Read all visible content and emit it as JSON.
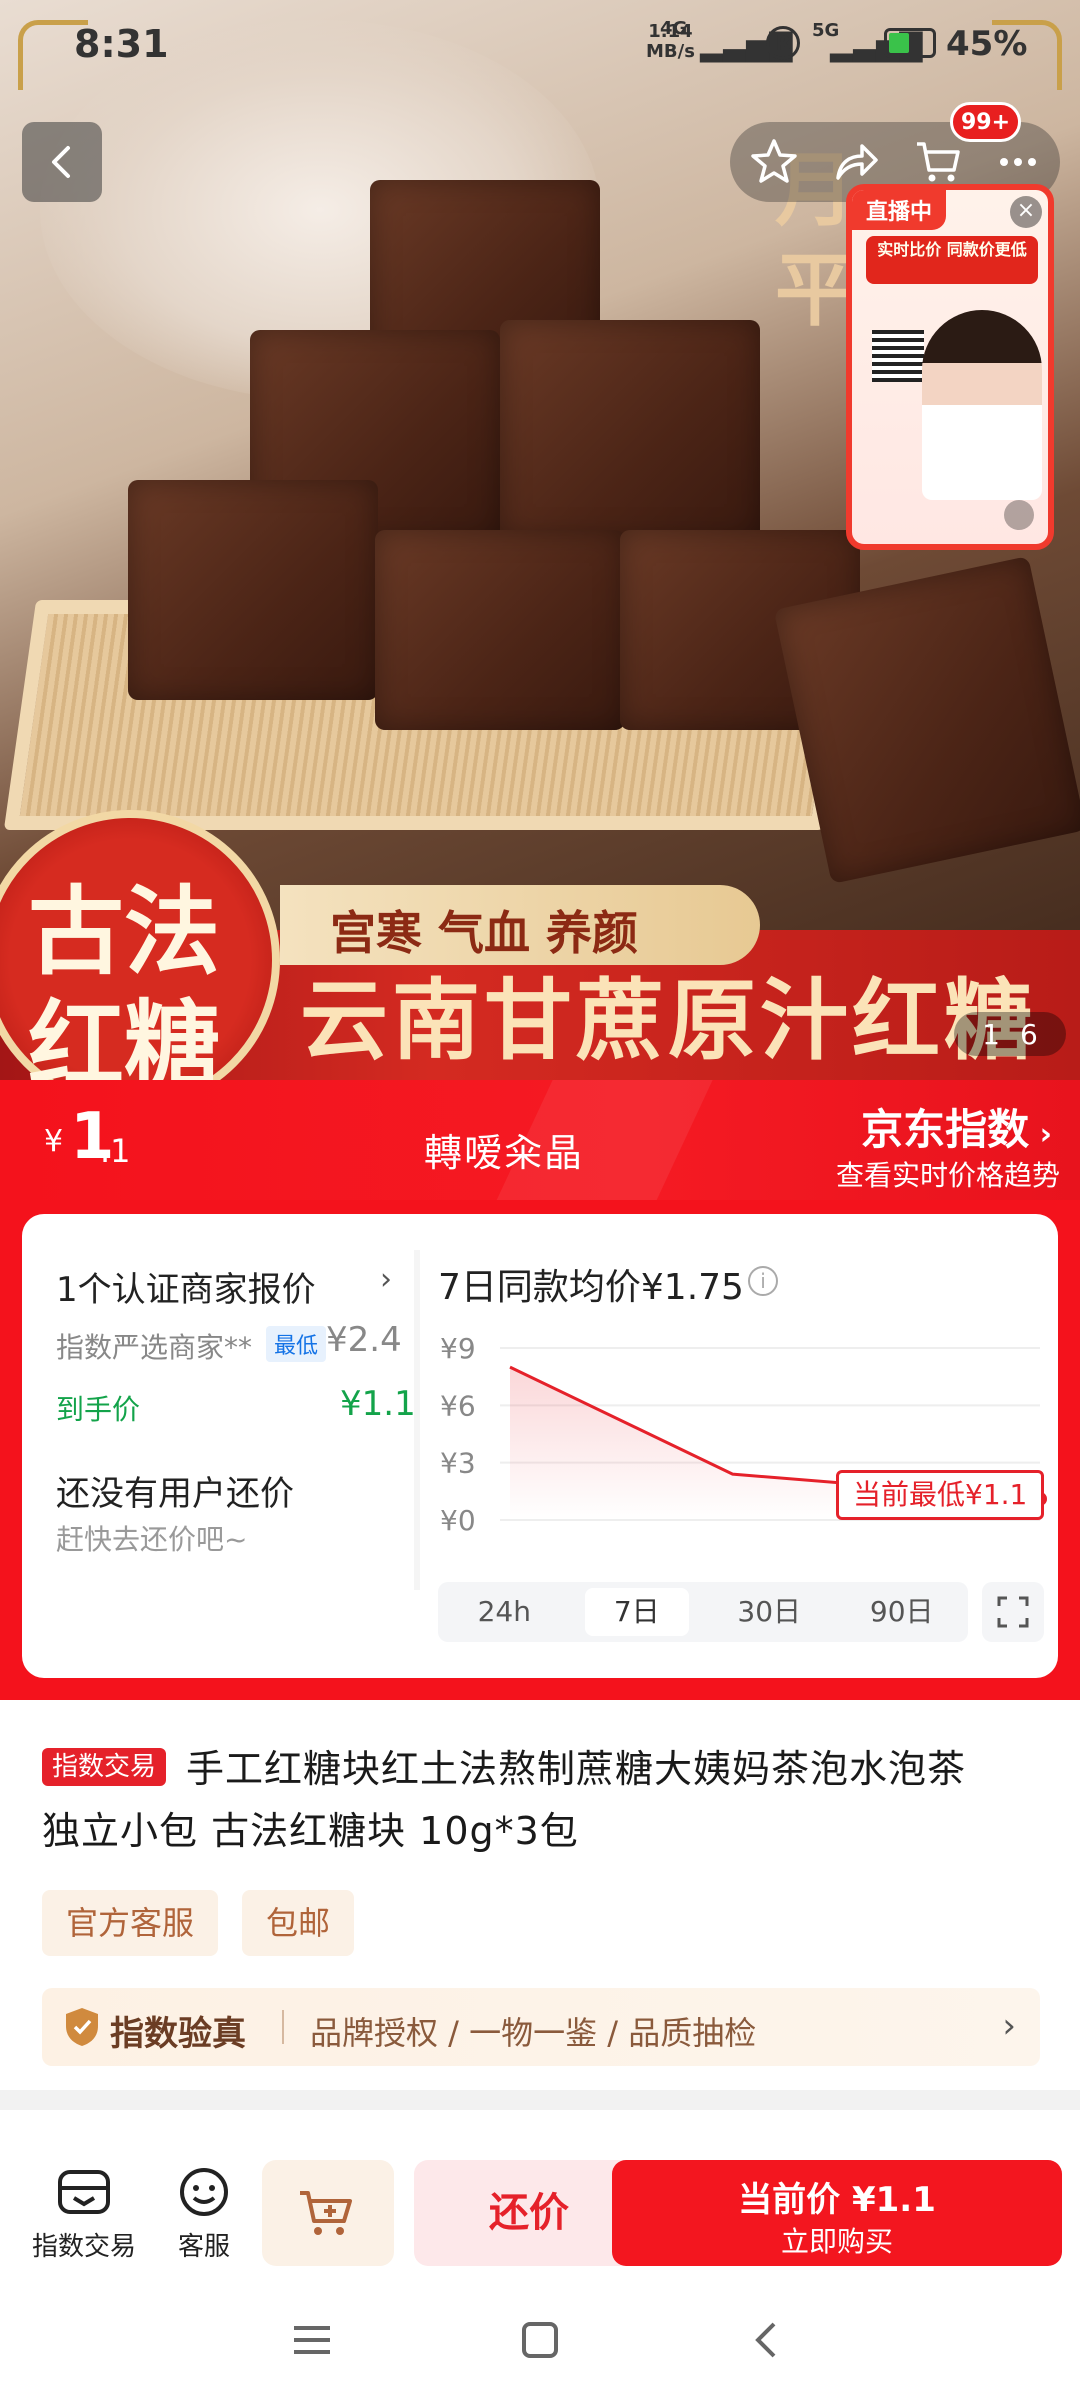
{
  "status_bar": {
    "time": "8:31",
    "net_speed": "1.14",
    "net_unit": "MB/s",
    "net_type": "4G",
    "sim2": "5G",
    "battery": "45%"
  },
  "hero": {
    "side_text": "月\n平",
    "badge_line1": "古法",
    "badge_line2": "红糖",
    "banner_gold": "宫寒 气血 养颜",
    "banner_red": "云南甘蔗原汁红糖",
    "image_index": "1",
    "image_total": "6",
    "cart_badge": "99+",
    "live": {
      "tag": "直播中",
      "promo": "实时比价 同款价更低"
    }
  },
  "price_strip": {
    "currency": "¥",
    "price_int": "1",
    "price_dec": ".1",
    "seller": "轉嗳籴晶",
    "index_title": "京东指数",
    "index_sub": "查看实时价格趋势"
  },
  "merchant": {
    "title": "1个认证商家报价",
    "seller_label": "指数严选商家**",
    "lowest_tag": "最低",
    "seller_price": "¥2.4",
    "hand_label": "到手价",
    "hand_price": "¥1.1"
  },
  "counter": {
    "title": "还没有用户还价",
    "subtitle": "赶快去还价吧~"
  },
  "chart_info_icon": "info-icon",
  "chart_data": {
    "type": "line",
    "title": "7日同款均价¥1.75",
    "x": [
      "start",
      "mid",
      "now"
    ],
    "series": [
      {
        "values": [
          8,
          2.4,
          1.1
        ]
      }
    ],
    "ytick_labels": [
      "¥9",
      "¥6",
      "¥3",
      "¥0"
    ],
    "ylim": [
      0,
      9
    ],
    "grid": true,
    "annotation": "当前最低¥1.1",
    "color": "#e5212a",
    "ranges": [
      "24h",
      "7日",
      "30日",
      "90日"
    ],
    "active_range": "7日"
  },
  "product": {
    "tag": "指数交易",
    "title_line1": "手工红糖块红土法熬制蔗糖大姨妈茶泡水泡茶",
    "title_line2": "独立小包 古法红糖块 10g*3包",
    "chips": [
      "官方客服",
      "包邮"
    ],
    "verify_title": "指数验真",
    "verify_desc": "品牌授权 / 一物一鉴 / 品质抽检"
  },
  "action_bar": {
    "store_label": "指数交易",
    "service_label": "客服",
    "bargain_label": "还价",
    "buy_line1": "当前价 ¥1.1",
    "buy_line2": "立即购买"
  },
  "colors": {
    "accent_red": "#f4121c",
    "green": "#13a34a",
    "brown": "#6b3d24"
  }
}
